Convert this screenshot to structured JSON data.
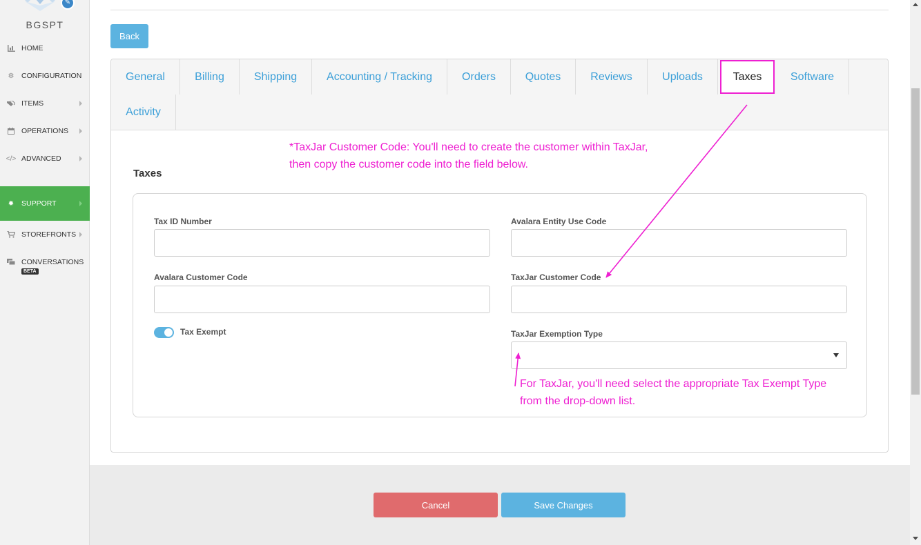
{
  "colors": {
    "accent": "#5cb3e0",
    "active_nav": "#4cb050",
    "annotation": "#ee1fd1",
    "danger": "#e06b6d",
    "link": "#3b9fd8"
  },
  "sidebar": {
    "brand": "BGSPT",
    "items": [
      {
        "label": "HOME",
        "icon": "bar-chart-icon"
      },
      {
        "label": "CONFIGURATION",
        "icon": "gear-icon"
      },
      {
        "label": "ITEMS",
        "icon": "tags-icon"
      },
      {
        "label": "OPERATIONS",
        "icon": "calendar-icon"
      },
      {
        "label": "ADVANCED",
        "icon": "code-icon"
      },
      {
        "label": "SUPPORT",
        "icon": "bug-icon"
      },
      {
        "label": "STOREFRONTS",
        "icon": "cart-icon"
      },
      {
        "label": "CONVERSATIONS",
        "icon": "chat-icon"
      }
    ],
    "beta_badge": "BETA"
  },
  "toolbar": {
    "back_label": "Back"
  },
  "tabs": [
    {
      "label": "General"
    },
    {
      "label": "Billing"
    },
    {
      "label": "Shipping"
    },
    {
      "label": "Accounting / Tracking"
    },
    {
      "label": "Orders"
    },
    {
      "label": "Quotes"
    },
    {
      "label": "Reviews"
    },
    {
      "label": "Uploads"
    },
    {
      "label": "Taxes"
    },
    {
      "label": "Software"
    },
    {
      "label": "Activity"
    }
  ],
  "section": {
    "title": "Taxes",
    "fields": {
      "tax_id": {
        "label": "Tax ID Number",
        "value": ""
      },
      "avalara_entity": {
        "label": "Avalara Entity Use Code",
        "value": ""
      },
      "avalara_customer": {
        "label": "Avalara Customer Code",
        "value": ""
      },
      "taxjar_customer": {
        "label": "TaxJar Customer Code",
        "value": ""
      },
      "taxjar_exemption": {
        "label": "TaxJar Exemption Type",
        "value": ""
      },
      "tax_exempt": {
        "label": "Tax Exempt",
        "checked": true
      }
    }
  },
  "annotations": {
    "taxjar_code_line1": "*TaxJar Customer Code: You'll need to create the customer within  TaxJar,",
    "taxjar_code_line2": "then copy the customer code into the field below.",
    "exemption_line1": "For TaxJar, you'll need select the appropriate Tax Exempt Type",
    "exemption_line2": "from the drop-down list."
  },
  "footer": {
    "cancel_label": "Cancel",
    "save_label": "Save Changes"
  }
}
